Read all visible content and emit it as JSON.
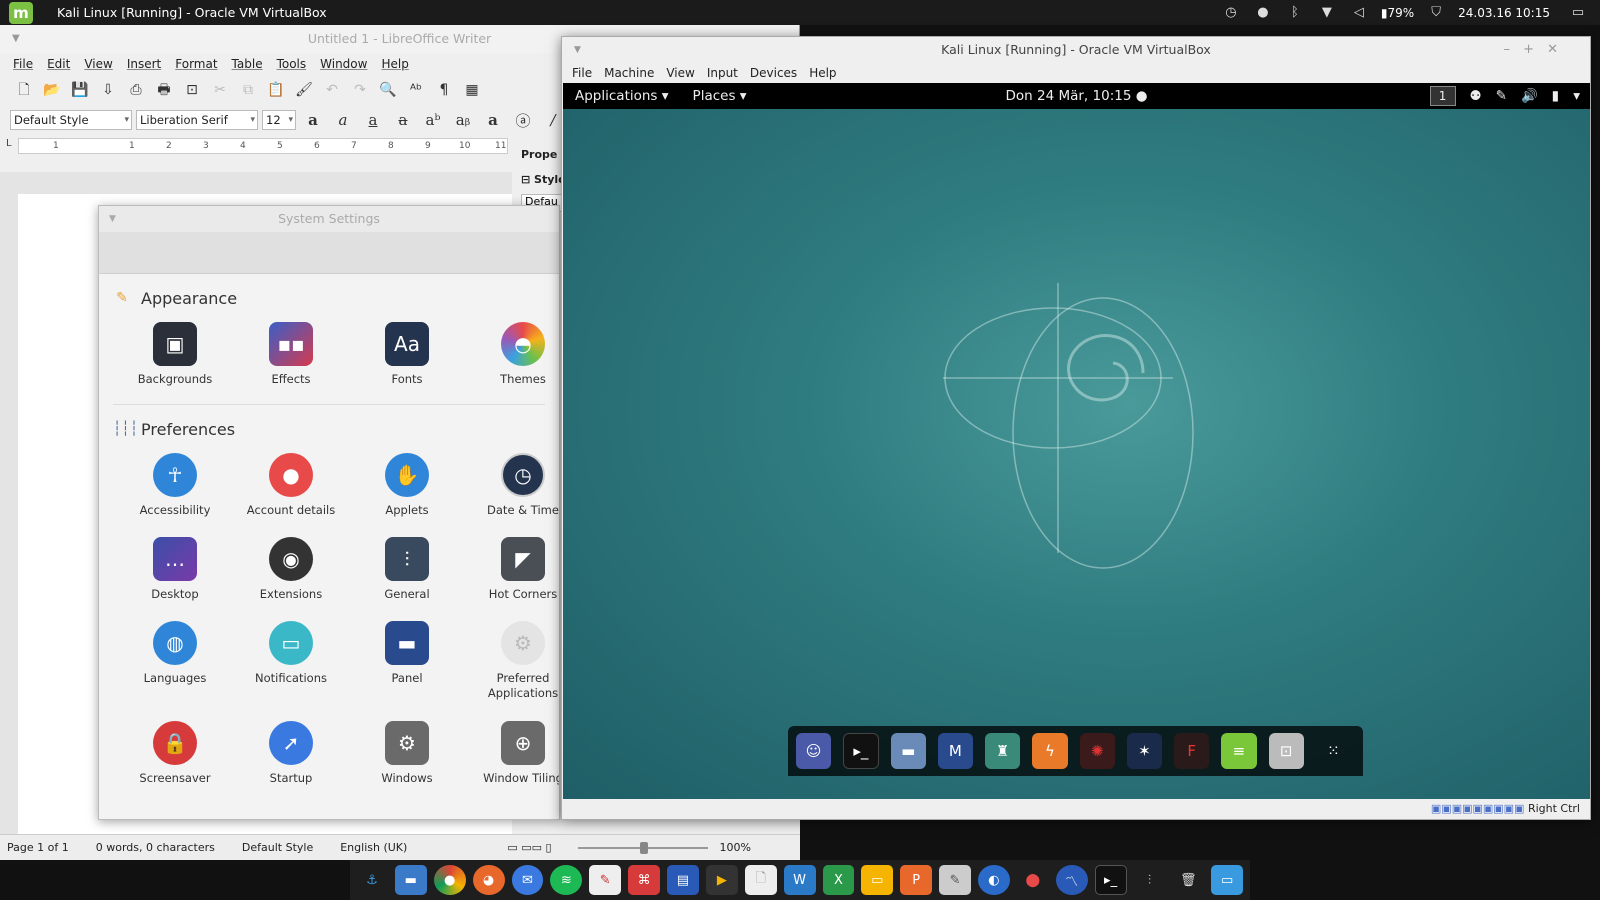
{
  "host_panel": {
    "active_window_title": "Kali Linux [Running] - Oracle VM VirtualBox",
    "battery": "79%",
    "datetime": "24.03.16 10:15"
  },
  "writer": {
    "title": "Untitled 1 - LibreOffice Writer",
    "menu": [
      "File",
      "Edit",
      "View",
      "Insert",
      "Format",
      "Table",
      "Tools",
      "Window",
      "Help"
    ],
    "paragraph_style": "Default Style",
    "font_name": "Liberation Serif",
    "font_size": "12",
    "ruler_marks": [
      "1",
      "1",
      "2",
      "3",
      "4",
      "5",
      "6",
      "7",
      "8",
      "9",
      "10",
      "11"
    ],
    "sidebar_header": "Prope",
    "sidebar_section": "Style",
    "sidebar_value": "Defau",
    "status": {
      "page": "Page 1 of 1",
      "words": "0 words, 0 characters",
      "style": "Default Style",
      "language": "English (UK)",
      "zoom": "100%"
    }
  },
  "settings": {
    "title": "System Settings",
    "appearance": {
      "label": "Appearance",
      "items": [
        "Backgrounds",
        "Effects",
        "Fonts",
        "Themes"
      ]
    },
    "preferences": {
      "label": "Preferences",
      "items": [
        "Accessibility",
        "Account details",
        "Applets",
        "Date & Time",
        "Desktop",
        "Extensions",
        "General",
        "Hot Corners",
        "Languages",
        "Notifications",
        "Panel",
        "Preferred Applications",
        "Screensaver",
        "Startup",
        "Windows",
        "Window Tiling"
      ]
    },
    "fonts_glyph": "Aa"
  },
  "vbox": {
    "title": "Kali Linux [Running] - Oracle VM VirtualBox",
    "menu": [
      "File",
      "Machine",
      "View",
      "Input",
      "Devices",
      "Help"
    ],
    "host_key": "Right Ctrl",
    "guest": {
      "applications": "Applications",
      "places": "Places",
      "clock": "Don 24 Mär, 10:15",
      "workspace": "1"
    }
  }
}
